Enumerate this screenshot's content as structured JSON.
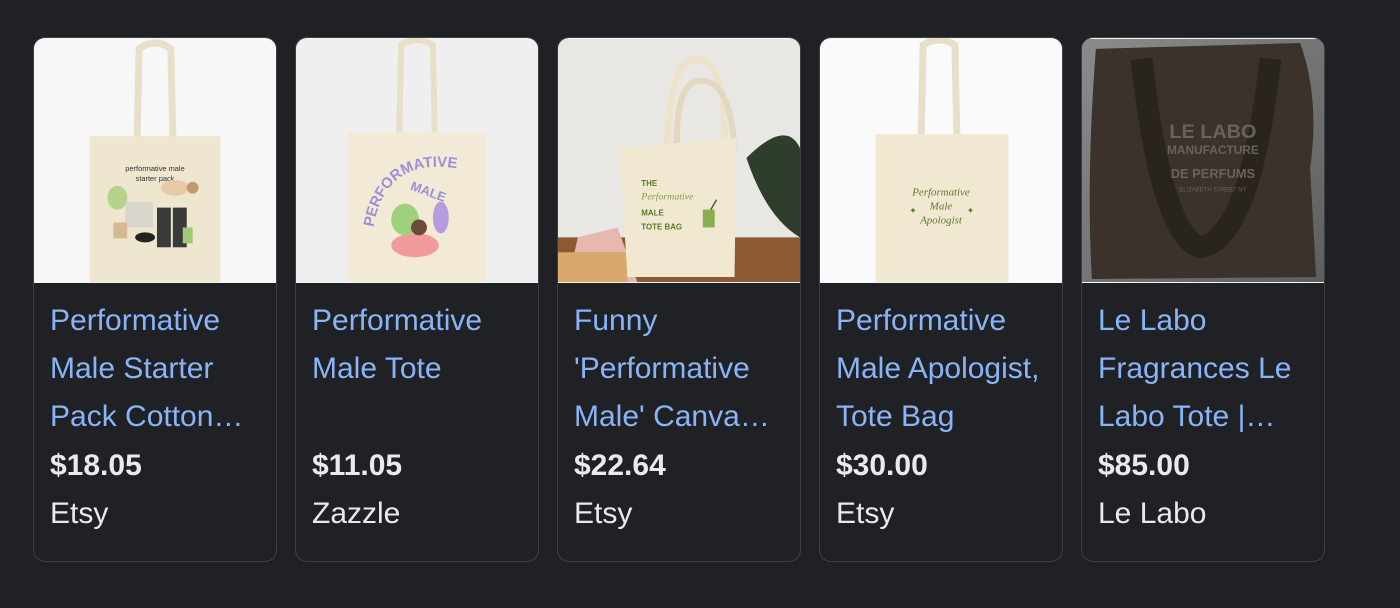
{
  "products": [
    {
      "title": "Performative Male Starter Pack Cotton Tote Bag",
      "price": "$18.05",
      "source": "Etsy",
      "image_text": [
        "performative male",
        "starter pack"
      ]
    },
    {
      "title": "Performative Male Tote",
      "price": "$11.05",
      "source": "Zazzle",
      "image_text": [
        "PERFORMATIVE",
        "MALE"
      ]
    },
    {
      "title": "Funny 'Performative Male' Canvas Tote Bag",
      "price": "$22.64",
      "source": "Etsy",
      "image_text": [
        "THE",
        "Performative",
        "MALE",
        "TOTE BAG"
      ]
    },
    {
      "title": "Performative Male Apologist, Tote Bag",
      "price": "$30.00",
      "source": "Etsy",
      "image_text": [
        "Performative",
        "Male",
        "Apologist"
      ]
    },
    {
      "title": "Le Labo Fragrances Le Labo Tote | Tote Bag",
      "price": "$85.00",
      "source": "Le Labo",
      "image_text": [
        "LE LABO",
        "MANUFACTURE",
        "DE PERFUMS",
        "ELIZABETH STREET NY"
      ]
    }
  ],
  "colors": {
    "background": "#202124",
    "title_link": "#8ab4f8",
    "text": "#e8eaed",
    "card_border": "#3c4043"
  }
}
